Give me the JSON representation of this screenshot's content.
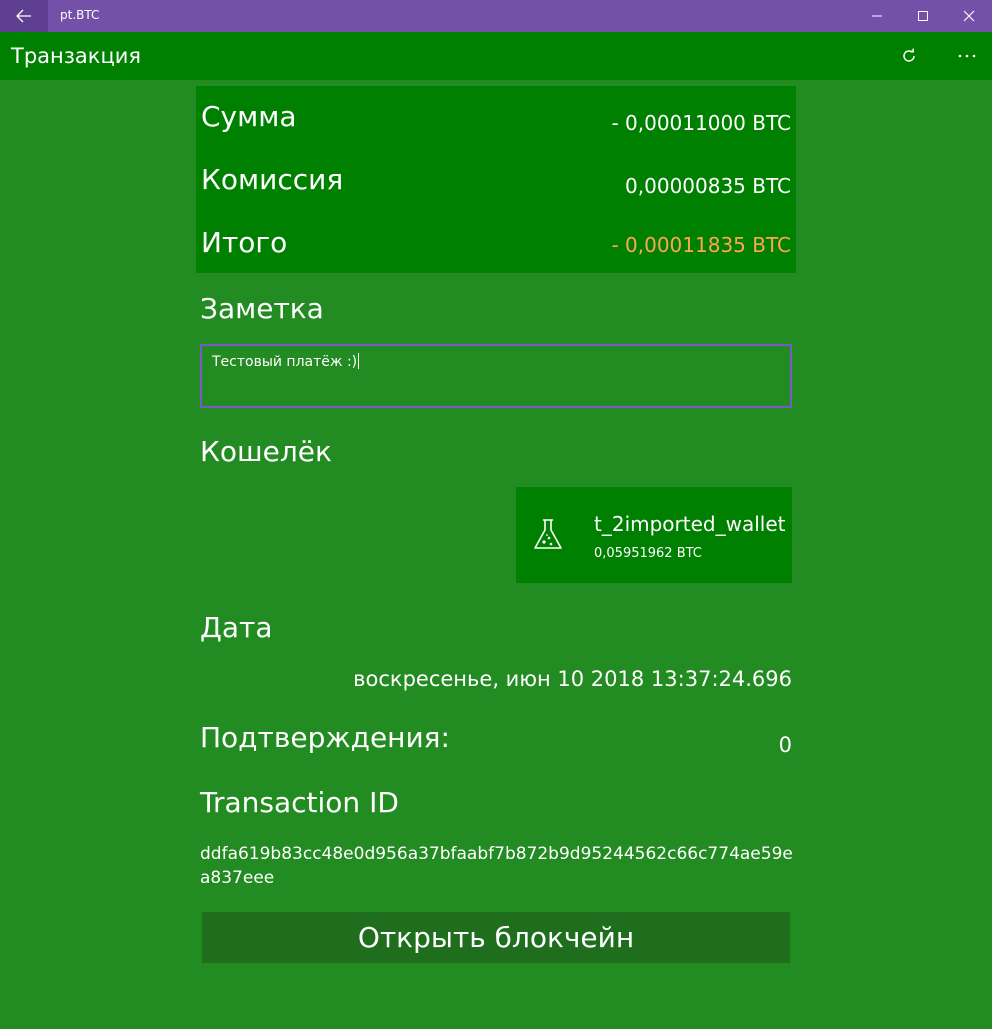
{
  "window": {
    "app_title": "pt.BTC"
  },
  "header": {
    "page_title": "Транзакция"
  },
  "summary": {
    "amount_label": "Сумма",
    "amount_value": "- 0,00011000 BTC",
    "fee_label": "Комиссия",
    "fee_value": "0,00000835 BTC",
    "total_label": "Итого",
    "total_value": "- 0,00011835 BTC",
    "total_color": "#ffa54f"
  },
  "note": {
    "label": "Заметка",
    "value": "Тестовый платёж :)"
  },
  "wallet": {
    "label": "Кошелёк",
    "name": "t_2imported_wallet",
    "balance": "0,05951962 BTC",
    "icon": "flask-icon"
  },
  "date": {
    "label": "Дата",
    "value": "воскресенье, июн 10 2018 13:37:24.696"
  },
  "confirmations": {
    "label": "Подтверждения:",
    "value": "0"
  },
  "transaction": {
    "label": "Transaction ID",
    "id": "ddfa619b83cc48e0d956a37bfaabf7b872b9d95244562c66c774ae59ea837eee"
  },
  "actions": {
    "open_blockchain": "Открыть блокчейн"
  },
  "colors": {
    "background": "#228b22",
    "panel": "#008000",
    "titlebar": "#7451a8",
    "button": "#1e6e1e"
  }
}
